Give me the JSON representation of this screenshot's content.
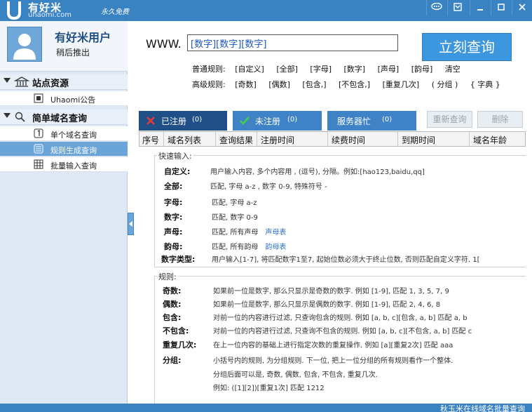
{
  "app": {
    "logo_name": "有好米",
    "logo_domain": "uhaomi.com",
    "free_tag": "永久免费",
    "status_text": "秋玉米在线域名批量查询"
  },
  "user": {
    "name": "有好米用户",
    "status": "稍后推出"
  },
  "sidebar": {
    "groups": [
      {
        "label": "站点资源",
        "items": [
          {
            "label": "Uhaomi公告"
          }
        ]
      },
      {
        "label": "简单域名查询",
        "items": [
          {
            "label": "单个域名查询"
          },
          {
            "label": "规则生成查询"
          },
          {
            "label": "批量输入查询"
          }
        ]
      }
    ]
  },
  "search": {
    "prefix": "WWW.",
    "value": "[数字][数字][数字]",
    "button": "立刻查询"
  },
  "rules": {
    "basic_label": "普通规则:",
    "basic": [
      "[自定义]",
      "[全部]",
      "[字母]",
      "[数字]",
      "[声母]",
      "[韵母]",
      "清空"
    ],
    "advanced_label": "高级规则:",
    "advanced": [
      "[奇数]",
      "[偶数]",
      "[包含,]",
      "[不包含,]",
      "[重复几次]",
      "( 分组 )",
      "{ 字典 }"
    ]
  },
  "tabs": [
    {
      "label": "已注册",
      "count": "(0)"
    },
    {
      "label": "未注册",
      "count": "(0)"
    },
    {
      "label": "服务器忙",
      "count": "(0)"
    }
  ],
  "actions": {
    "requery": "重新查询",
    "delete": "删除"
  },
  "table": {
    "columns": [
      "序号",
      "域名列表",
      "查询结果",
      "注册时间",
      "续费时间",
      "到期时间",
      "域名年龄"
    ]
  },
  "help": {
    "quick_title": "快速输入:",
    "quick": [
      {
        "k": "自定义:",
        "v": "用户输入内容, 多个内容用 , (逗号), 分隔。例如:[hao123,baidu,qq]"
      },
      {
        "k": "全部:",
        "v": "匹配, 字母 a-z , 数字 0-9, 特殊符号 -"
      },
      {
        "k": "字母:",
        "v": "匹配, 字母 a-z"
      },
      {
        "k": "数字:",
        "v": "匹配, 数字 0-9"
      },
      {
        "k": "声母:",
        "v": "匹配, 所有声母",
        "link": "声母表"
      },
      {
        "k": "韵母:",
        "v": "匹配, 所有韵母",
        "link": "韵母表"
      },
      {
        "k": "数字类型:",
        "v": "用户输入[1-7], 将匹配数字1至7, 起始位数必须大于终止位数, 否则匹配自定义字符. 1["
      }
    ],
    "rules_title": "规则:",
    "rules": [
      {
        "k": "奇数:",
        "v": "如果前一位是数字, 那么只显示是奇数的数字. 例如 [1-9], 匹配 1, 3, 5, 7, 9"
      },
      {
        "k": "偶数:",
        "v": "如果前一位是数字, 那么只显示是偶数的数字. 例如 [1-9], 匹配 2, 4, 6, 8"
      },
      {
        "k": "包含:",
        "v": "对前一位的内容进行过滤, 只查询包含的规则. 例如 [a, b, c][包含, a, b] 匹配 a, b"
      },
      {
        "k": "不包含:",
        "v": "对前一位的内容进行过滤, 只查询不包含的规则. 例如 [a, b, c][不包含, a, b] 匹配 c"
      },
      {
        "k": "重复几次:",
        "v": "在上一位内容的基础上进行指定次数的重复操作. 例如 [a][重复2次] 匹配 aaa"
      },
      {
        "k": "分组:",
        "v": "小括号内的规则, 为分组规则. 下一位, 把上一位分组的所有规则看作一个整体."
      }
    ],
    "group_extra_1": "分组后面可以是, 奇数, 偶数, 包含, 不包含, 重复几次.",
    "group_extra_2": "例如: ([1][2])[重复1次] 匹配 1212"
  },
  "colors": {
    "titlebar": "#3a83c3",
    "accent": "#3d97de",
    "tab_active": "#1f4f86",
    "tab_green": "#3f82c5"
  }
}
